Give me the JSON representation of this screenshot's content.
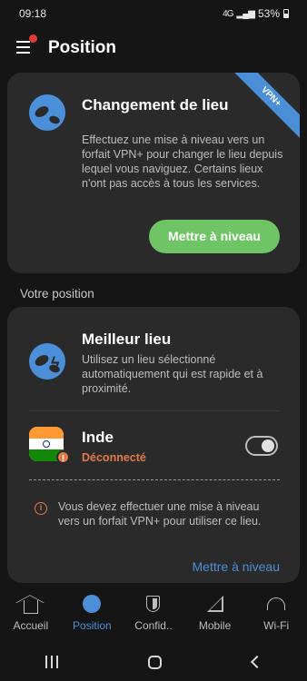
{
  "status": {
    "time": "09:18",
    "battery": "53%",
    "network": "4G"
  },
  "header": {
    "title": "Position"
  },
  "upgrade_card": {
    "badge": "VPN+",
    "title": "Changement de lieu",
    "description": "Effectuez une mise à niveau vers un forfait VPN+ pour changer le lieu depuis lequel vous naviguez. Certains lieux n'ont pas accès à tous les services.",
    "button": "Mettre à niveau",
    "accent": "#6fc465"
  },
  "position_section": {
    "label": "Votre position",
    "best": {
      "title": "Meilleur lieu",
      "description": "Utilisez un lieu sélectionné automatiquement qui est rapide et à proximité."
    },
    "country": {
      "name": "Inde",
      "status": "Déconnecté",
      "status_color": "#e07a4a",
      "toggle_on": false
    },
    "notice": "Vous devez effectuer une mise à niveau vers un forfait VPN+ pour utiliser ce lieu.",
    "link": "Mettre à niveau"
  },
  "nav": {
    "items": [
      {
        "label": "Accueil",
        "icon": "home-icon"
      },
      {
        "label": "Position",
        "icon": "globe-icon",
        "active": true
      },
      {
        "label": "Confid..",
        "icon": "shield-icon"
      },
      {
        "label": "Mobile",
        "icon": "mobile-signal-icon"
      },
      {
        "label": "Wi-Fi",
        "icon": "wifi-icon"
      }
    ]
  },
  "colors": {
    "accent": "#4a8fd8",
    "background": "#151515",
    "card": "#2a2a2a"
  }
}
